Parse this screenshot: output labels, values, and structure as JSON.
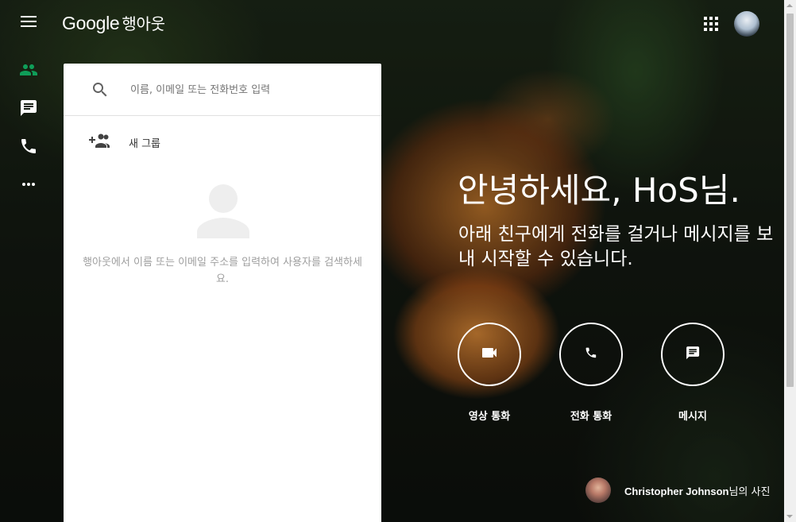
{
  "app": {
    "brand": "Google",
    "product": "행아웃"
  },
  "colors": {
    "accent_green": "#0f9d58",
    "panel_bg": "#ffffff",
    "text_white": "#ffffff"
  },
  "rail": {
    "items": [
      {
        "name": "contacts",
        "icon": "people-icon",
        "active": true
      },
      {
        "name": "conversations",
        "icon": "chat-icon",
        "active": false
      },
      {
        "name": "phone",
        "icon": "phone-icon",
        "active": false
      },
      {
        "name": "more",
        "icon": "more-horiz-icon",
        "active": false
      }
    ]
  },
  "panel": {
    "search_placeholder": "이름, 이메일 또는 전화번호 입력",
    "new_group_label": "새 그룹",
    "empty_message": "행아웃에서 이름 또는 이메일 주소를 입력하여 사용자를 검색하세요."
  },
  "main": {
    "greeting": "안녕하세요, HoS님.",
    "subtitle": "아래 친구에게 전화를 걸거나 메시지를 보내 시작할 수 있습니다.",
    "actions": [
      {
        "label": "영상 통화",
        "icon": "videocam-icon"
      },
      {
        "label": "전화 통화",
        "icon": "phone-icon"
      },
      {
        "label": "메시지",
        "icon": "message-icon"
      }
    ]
  },
  "credit": {
    "name": "Christopher Johnson",
    "suffix": "님의 사진"
  }
}
